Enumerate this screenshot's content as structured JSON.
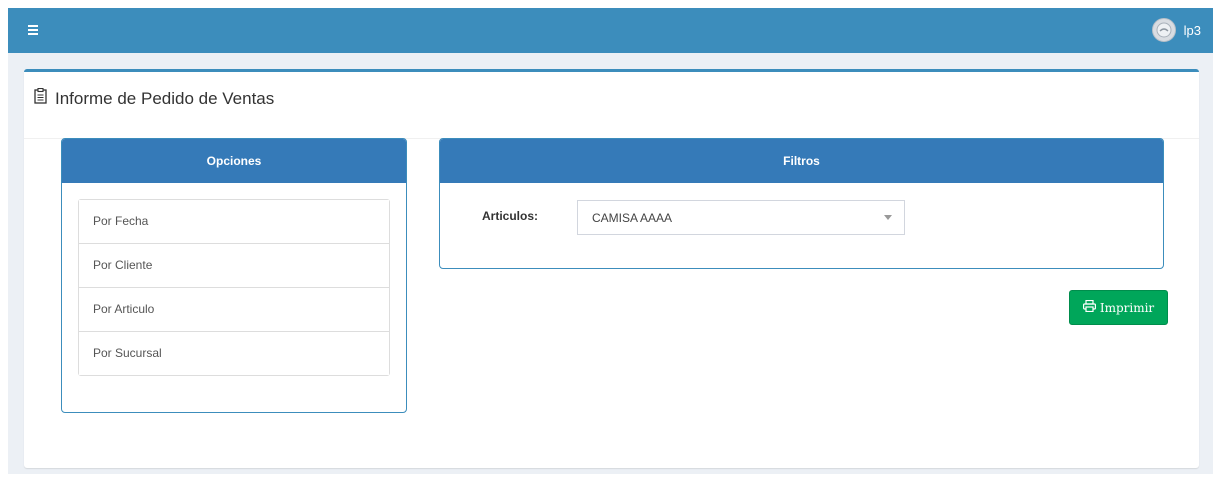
{
  "navbar": {
    "menu_icon": "hamburger-icon",
    "user_name": "lp3",
    "avatar_icon": "user-avatar-icon",
    "color": "#3c8dbc"
  },
  "report": {
    "icon": "clipboard-icon",
    "title": "Informe de Pedido de Ventas"
  },
  "opciones": {
    "title": "Opciones",
    "items": [
      {
        "label": "Por Fecha"
      },
      {
        "label": "Por Cliente"
      },
      {
        "label": "Por Articulo"
      },
      {
        "label": "Por Sucursal"
      }
    ]
  },
  "filtros": {
    "title": "Filtros",
    "articulos_label": "Articulos:",
    "articulos_value": "CAMISA AAAA"
  },
  "actions": {
    "print_label": "Imprimir",
    "print_icon": "printer-icon",
    "print_color": "#00a65a"
  }
}
